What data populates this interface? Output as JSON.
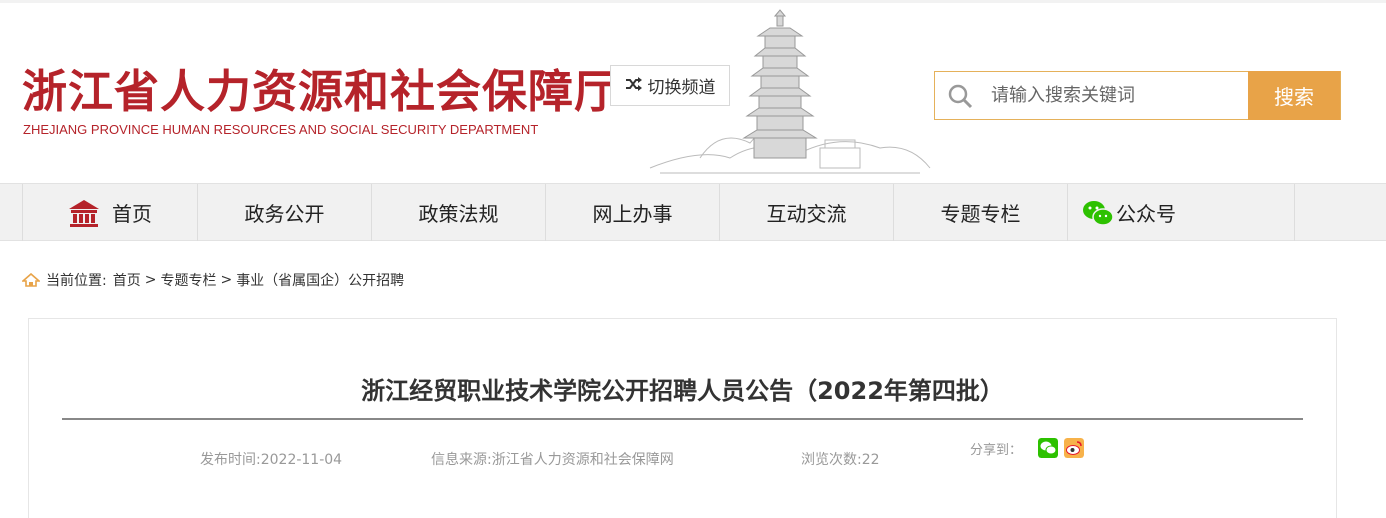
{
  "header": {
    "title_cn": "浙江省人力资源和社会保障厅",
    "title_en": "ZHEJIANG PROVINCE HUMAN RESOURCES AND SOCIAL SECURITY DEPARTMENT",
    "switch_label": "切换频道",
    "switch_icon": "shuffle-icon"
  },
  "search": {
    "placeholder": "请输入搜索关键词",
    "button": "搜索"
  },
  "nav": {
    "items": [
      {
        "label": "首页",
        "icon": "home-icon"
      },
      {
        "label": "政务公开"
      },
      {
        "label": "政策法规"
      },
      {
        "label": "网上办事"
      },
      {
        "label": "互动交流"
      },
      {
        "label": "专题专栏"
      },
      {
        "label": "公众号",
        "icon": "wechat-icon"
      }
    ]
  },
  "breadcrumb": {
    "prefix": "当前位置:",
    "items": [
      "首页",
      "专题专栏",
      "事业（省属国企）公开招聘"
    ],
    "separator": ">"
  },
  "article": {
    "title": "浙江经贸职业技术学院公开招聘人员公告（2022年第四批）",
    "publish_time": "发布时间:2022-11-04",
    "source": "信息来源:浙江省人力资源和社会保障网",
    "views": "浏览次数:22",
    "share_label": "分享到："
  },
  "colors": {
    "brand_red": "#b5232a",
    "accent_orange": "#e8a348",
    "wechat_green": "#2dc100",
    "weibo_orange": "#f7b24a"
  }
}
